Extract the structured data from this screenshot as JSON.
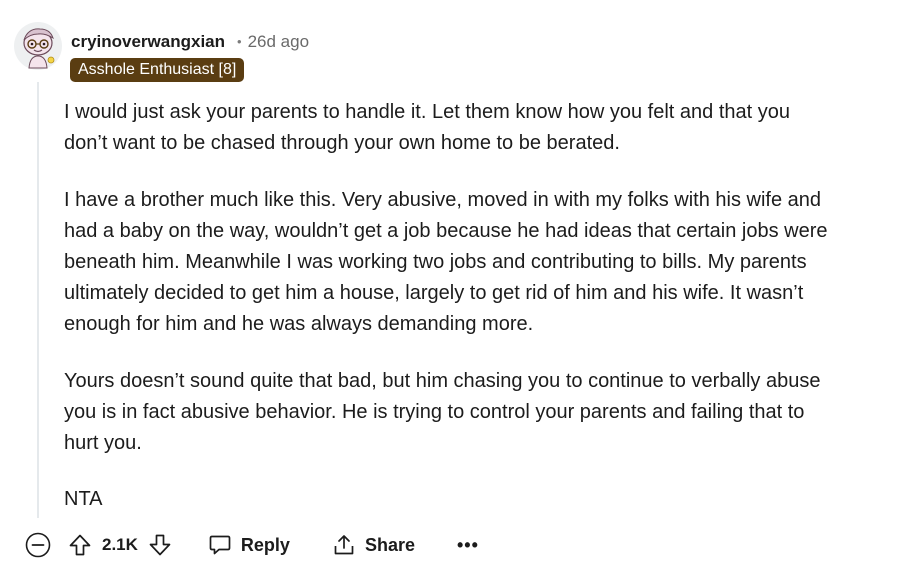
{
  "comment": {
    "author": "cryinoverwangxian",
    "separator": "•",
    "timestamp": "26d ago",
    "flair": "Asshole Enthusiast [8]",
    "flair_color": "#5a3d12",
    "avatar_icon": "snoo-avatar-icon",
    "paragraphs": [
      "I would just ask your parents to handle it. Let them know how you felt and that you\ndon’t want to be chased through your own home to be berated.",
      "I have a brother much like this. Very abusive, moved in with my folks with his wife and\nhad a baby on the way, wouldn’t get a job because he had ideas that certain jobs were\nbeneath him. Meanwhile I was working two jobs and contributing to bills. My parents\nultimately decided to get him a house, largely to get rid of him and his wife. It wasn’t\nenough for him and he was always demanding more.",
      "Yours doesn’t sound quite that bad, but him chasing you to continue to verbally abuse\nyou is in fact abusive behavior. He is trying to control your parents and failing that to\nhurt you.",
      "NTA"
    ]
  },
  "actions": {
    "collapse_icon": "collapse-minus-icon",
    "upvote_icon": "upvote-arrow-icon",
    "score": "2.1K",
    "downvote_icon": "downvote-arrow-icon",
    "reply_icon": "speech-bubble-icon",
    "reply_label": "Reply",
    "share_icon": "share-icon",
    "share_label": "Share",
    "more_label": "•••"
  }
}
